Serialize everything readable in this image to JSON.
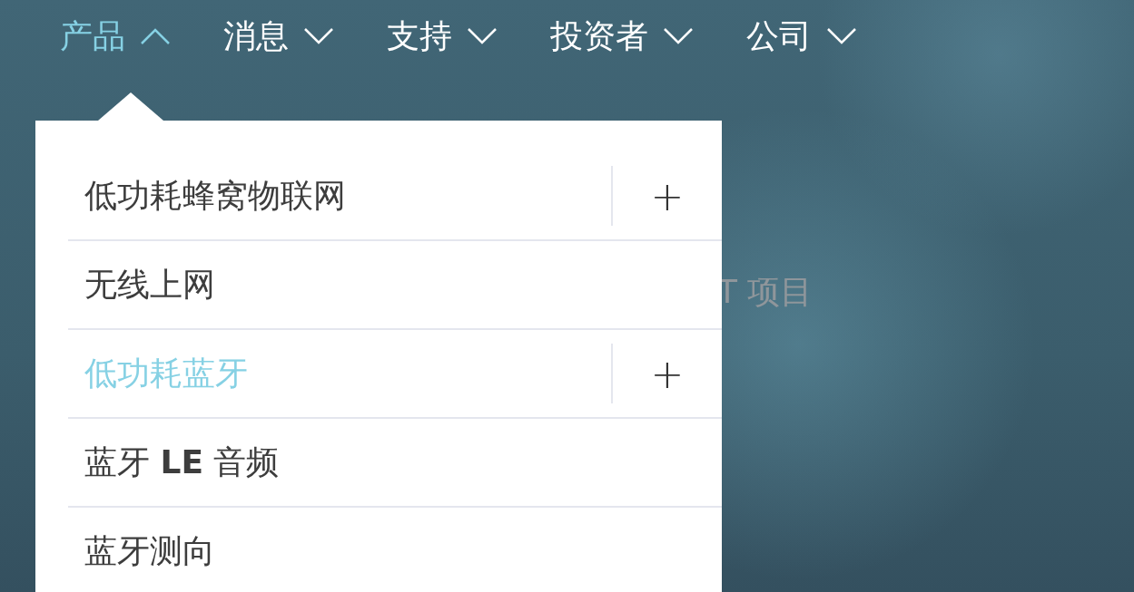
{
  "nav": {
    "items": [
      {
        "label": "产品",
        "expanded": true
      },
      {
        "label": "消息",
        "expanded": false
      },
      {
        "label": "支持",
        "expanded": false
      },
      {
        "label": "投资者",
        "expanded": false
      },
      {
        "label": "公司",
        "expanded": false
      }
    ]
  },
  "hero": {
    "subtitle": "T 项目"
  },
  "dropdown": {
    "items": [
      {
        "label": "低功耗蜂窝物联网",
        "selected": false,
        "expandable": true,
        "toggle": "+"
      },
      {
        "label": "无线上网",
        "selected": false,
        "expandable": false
      },
      {
        "label": "低功耗蓝牙",
        "selected": true,
        "expandable": true,
        "toggle": "+"
      },
      {
        "label": "蓝牙 **LE** 音频",
        "selected": false,
        "expandable": false
      },
      {
        "label": "蓝牙测向",
        "selected": false,
        "expandable": false
      }
    ]
  }
}
